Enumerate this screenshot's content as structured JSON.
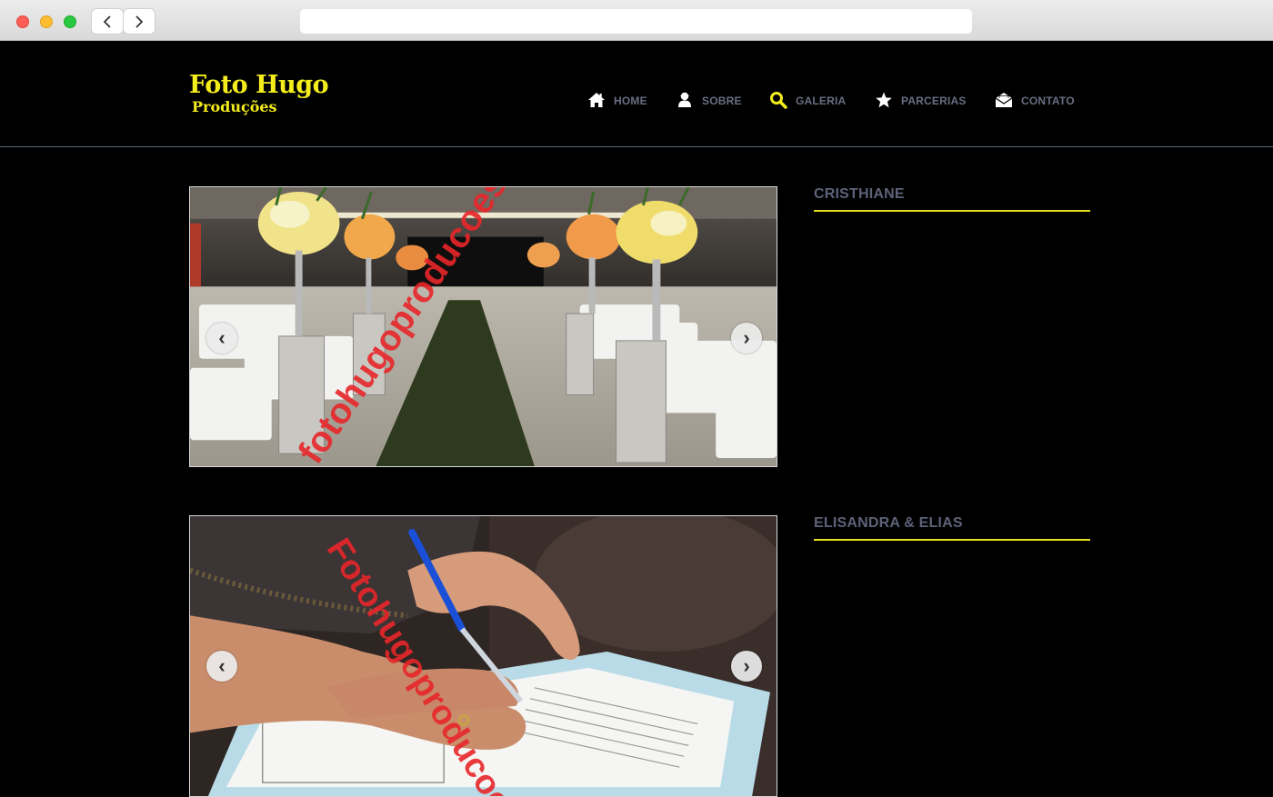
{
  "browser": {
    "url": ""
  },
  "site": {
    "logo_title": "Foto Hugo",
    "logo_subtitle": "Produções",
    "brand_color": "#f4ec1c"
  },
  "nav": {
    "items": [
      {
        "label": "HOME",
        "icon": "home-icon"
      },
      {
        "label": "SOBRE",
        "icon": "person-icon"
      },
      {
        "label": "GALERIA",
        "icon": "search-icon",
        "active": true
      },
      {
        "label": "PARCERIAS",
        "icon": "star-icon"
      },
      {
        "label": "CONTATO",
        "icon": "envelope-icon"
      }
    ]
  },
  "albums": [
    {
      "title": "CRISTHIANE",
      "watermark": "fotohugoproducoes.com.br",
      "prev": "‹",
      "next": "›"
    },
    {
      "title": "ELISANDRA & ELIAS",
      "watermark": "Fotohugoproducoes",
      "prev": "‹",
      "next": "›"
    }
  ],
  "colors": {
    "accent_underline": "#e5e01e",
    "nav_text": "#6a6e82",
    "watermark": "#e8262a"
  }
}
